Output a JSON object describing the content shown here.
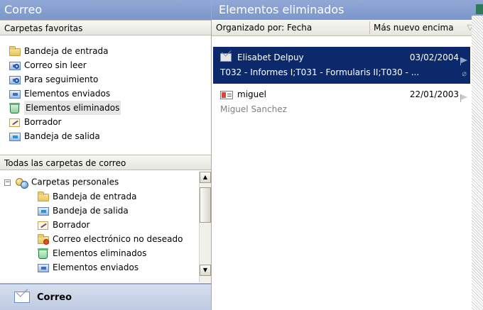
{
  "nav": {
    "header": "Correo",
    "favorites_title": "Carpetas favoritas",
    "favorites": [
      {
        "label": "Bandeja de entrada",
        "icon": "inbox-folder-icon"
      },
      {
        "label": "Correo sin leer",
        "icon": "search-folder-icon"
      },
      {
        "label": "Para seguimiento",
        "icon": "search-folder-icon"
      },
      {
        "label": "Elementos enviados",
        "icon": "sent-items-icon"
      },
      {
        "label": "Elementos eliminados",
        "icon": "deleted-items-icon",
        "selected": true
      },
      {
        "label": "Borrador",
        "icon": "drafts-icon"
      },
      {
        "label": "Bandeja de salida",
        "icon": "outbox-icon"
      }
    ],
    "all_folders_title": "Todas las carpetas de correo",
    "tree_root": {
      "expander": "−",
      "label": "Carpetas personales"
    },
    "tree": [
      {
        "label": "Bandeja de entrada",
        "icon": "inbox-folder-icon"
      },
      {
        "label": "Bandeja de salida",
        "icon": "outbox-icon"
      },
      {
        "label": "Borrador",
        "icon": "drafts-icon"
      },
      {
        "label": "Correo electrónico no deseado",
        "icon": "junk-mail-icon"
      },
      {
        "label": "Elementos eliminados",
        "icon": "deleted-items-icon"
      },
      {
        "label": "Elementos enviados",
        "icon": "sent-items-icon"
      }
    ],
    "mail_button": "Correo"
  },
  "list": {
    "header": "Elementos eliminados",
    "arranged_by": "Organizado por: Fecha",
    "sort_order": "Más nuevo encima",
    "messages": [
      {
        "from": "Elisabet Delpuy",
        "date": "03/02/2004",
        "preview": "T032 - Informes I;T031 - Formularis II;T030 - ...",
        "selected": true,
        "icon": "read-envelope-icon",
        "attachment": true
      },
      {
        "from": "miguel",
        "date": "22/01/2003",
        "preview": "Miguel Sanchez",
        "selected": false,
        "icon": "contact-card-icon",
        "attachment": false
      }
    ]
  },
  "colors": {
    "header_blue": "#7b96cb",
    "selection_navy": "#0c2a6b"
  }
}
